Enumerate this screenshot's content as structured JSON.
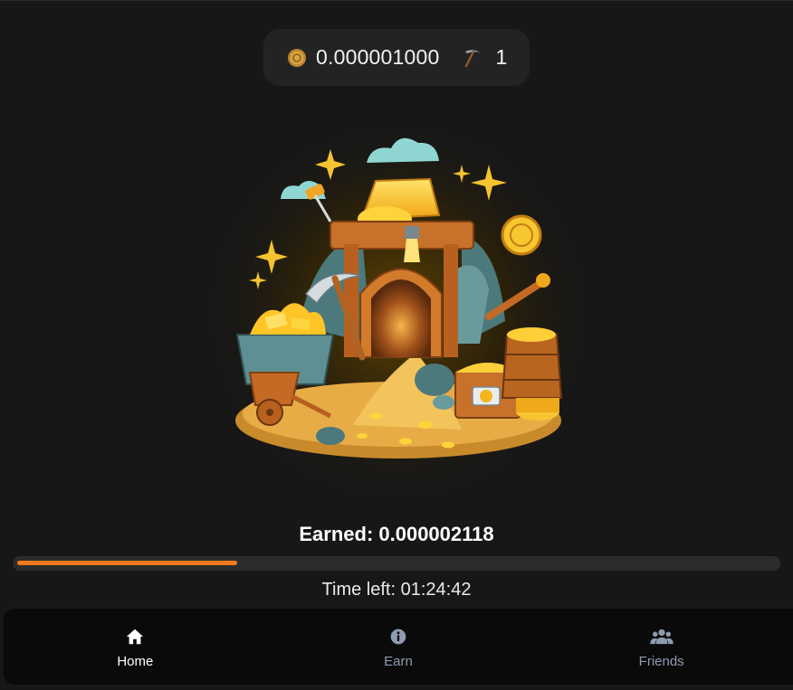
{
  "header": {
    "balance": "0.000001000",
    "pickaxe_count": "1",
    "coin_icon": "gold-coin-icon",
    "pickaxe_icon": "pickaxe-icon"
  },
  "mining": {
    "earned_text": "Earned: 0.000002118",
    "progress_fraction": 0.29,
    "time_left_text": "Time left: 01:24:42"
  },
  "nav": {
    "items": [
      {
        "label": "Home",
        "icon": "home-icon",
        "active": true
      },
      {
        "label": "Earn",
        "icon": "info-icon",
        "active": false
      },
      {
        "label": "Friends",
        "icon": "users-icon",
        "active": false
      }
    ]
  },
  "colors": {
    "background": "#171717",
    "accent": "#f07a1f",
    "nav_inactive": "#8e9bb0",
    "gold": "#f5b919"
  }
}
